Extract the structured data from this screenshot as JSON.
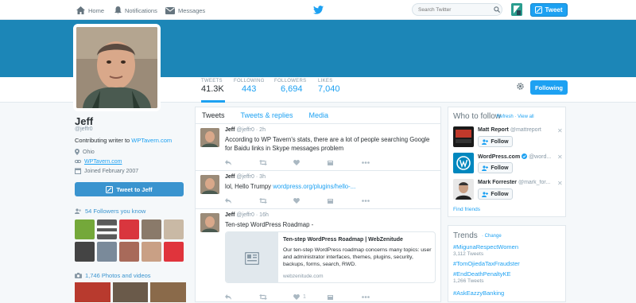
{
  "nav": {
    "home": "Home",
    "notifications": "Notifications",
    "messages": "Messages",
    "search_placeholder": "Search Twitter",
    "tweet_button": "Tweet"
  },
  "profile": {
    "stats": [
      {
        "label": "TWEETS",
        "value": "41.3K"
      },
      {
        "label": "FOLLOWING",
        "value": "443"
      },
      {
        "label": "FOLLOWERS",
        "value": "6,694"
      },
      {
        "label": "LIKES",
        "value": "7,040"
      }
    ],
    "following_button": "Following",
    "name": "Jeff",
    "handle": "@jeffr0",
    "bio_prefix": "Contributing writer to ",
    "bio_link": "WPTavern.com",
    "location": "Ohio",
    "website": "WPTavern.com",
    "joined": "Joined February 2007",
    "tweet_to_button": "Tweet to Jeff",
    "followers_you_know": "54 Followers you know",
    "photos_videos": "1,746 Photos and videos"
  },
  "timeline": {
    "tabs": [
      "Tweets",
      "Tweets & replies",
      "Media"
    ],
    "tweets": [
      {
        "name": "Jeff",
        "handle": "@jeffr0",
        "time": "· 2h",
        "text": "According to WP Tavern's stats, there are a lot of people searching Google for Baidu links in Skype messages problem"
      },
      {
        "name": "Jeff",
        "handle": "@jeffr0",
        "time": "· 3h",
        "text": "lol, Hello Trumpy ",
        "link": "wordpress.org/plugins/hello-..."
      },
      {
        "name": "Jeff",
        "handle": "@jeffr0",
        "time": "· 16h",
        "text": "Ten-step WordPress Roadmap -",
        "like_count": "1",
        "card": {
          "title": "Ten-step WordPress Roadmap | WebZenitude",
          "description": "Our ten-step WordPress roadmap concerns many topics: user and administrator interfaces, themes, plugins, security, backups, forms, search, RWD.",
          "url": "webzenitude.com"
        }
      }
    ]
  },
  "who_to_follow": {
    "title": "Who to follow",
    "refresh": "· Refresh",
    "view_all": "· View all",
    "follow_label": "Follow",
    "suggestions": [
      {
        "name": "Matt Report",
        "handle": "@mattreport"
      },
      {
        "name": "WordPress.com",
        "handle": "@word..."
      },
      {
        "name": "Mark Forrester",
        "handle": "@mark_for..."
      }
    ],
    "find_friends": "Find friends"
  },
  "trends": {
    "title": "Trends",
    "change": "· Change",
    "items": [
      {
        "name": "#MigunaRespectWomen",
        "count": "3,112 Tweets"
      },
      {
        "name": "#TomOjiedaTaxFraudster",
        "count": ""
      },
      {
        "name": "#EndDeathPenaltyKE",
        "count": "1,266 Tweets"
      },
      {
        "name": "#AskEazzyBanking",
        "count": ""
      }
    ]
  },
  "colors": {
    "accent": "#1da1f2",
    "banner": "#1c86b7",
    "verified": "#1da1f2"
  }
}
